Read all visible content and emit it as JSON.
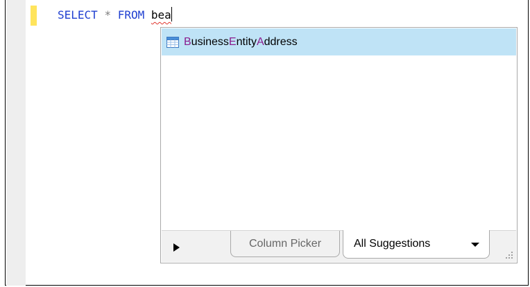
{
  "editor": {
    "keyword_select": "SELECT",
    "operator_star": "*",
    "keyword_from": "FROM",
    "typed_text": "bea"
  },
  "autocomplete": {
    "suggestions": [
      {
        "icon": "table-icon",
        "label_parts": [
          "B",
          "usiness",
          "E",
          "ntity",
          "A",
          "ddress"
        ],
        "selected": true
      }
    ],
    "tabs": {
      "column_picker": "Column Picker",
      "all_suggestions": "All Suggestions"
    }
  },
  "colors": {
    "keyword": "#1f3fd0",
    "match_highlight": "#8b1d8e",
    "selection": "#bfe3f6",
    "change_marker": "#ffe45c"
  }
}
